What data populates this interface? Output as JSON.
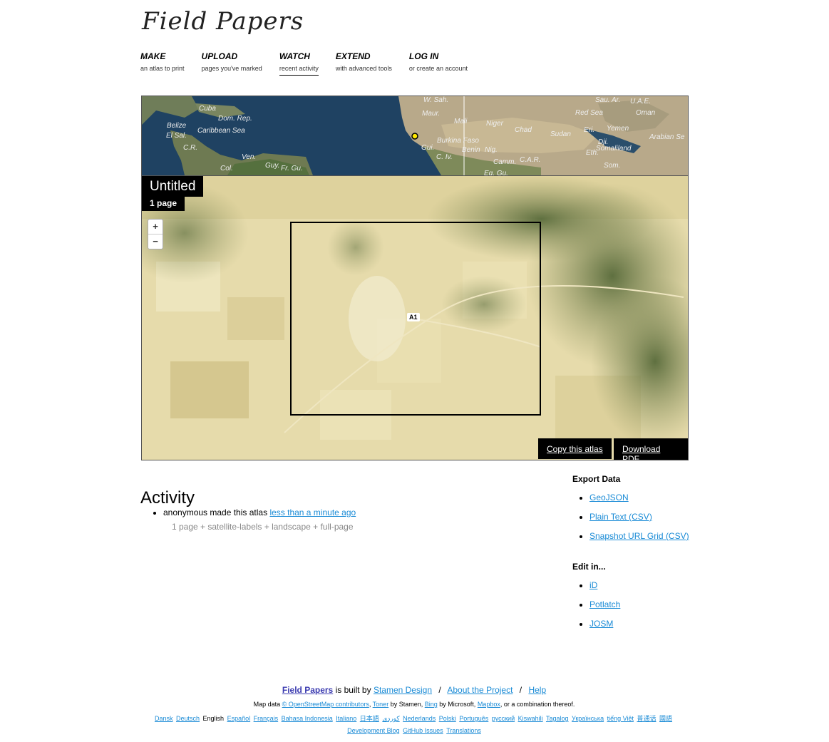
{
  "header": {
    "logo_text": "Field Papers"
  },
  "nav": [
    {
      "title": "MAKE",
      "subtitle": "an atlas to print",
      "active": false
    },
    {
      "title": "UPLOAD",
      "subtitle": "pages you've marked",
      "active": false
    },
    {
      "title": "WATCH",
      "subtitle": "recent activity",
      "active": true
    },
    {
      "title": "EXTEND",
      "subtitle": "with advanced tools",
      "active": false
    },
    {
      "title": "LOG IN",
      "subtitle": "or create an account",
      "active": false
    }
  ],
  "overview_map": {
    "labels": [
      "W. Sah.",
      "Cuba",
      "Dom. Rep.",
      "Belize",
      "Caribbean Sea",
      "El Sal.",
      "C.R.",
      "Ven.",
      "Col.",
      "Guy.",
      "Fr. Gu.",
      "Maur.",
      "Mali",
      "Niger",
      "Chad",
      "Sudan",
      "Red Sea",
      "Eri.",
      "Yemen",
      "Oman",
      "U.A.E.",
      "Sau. Ar.",
      "Arabian Se",
      "Burkina Faso",
      "Benin",
      "Nig.",
      "C. Iv.",
      "Gui.",
      "Camm.",
      "C.A.R.",
      "Eth.",
      "Dji.",
      "Somaliland",
      "Som.",
      "Eq. Gu."
    ]
  },
  "atlas": {
    "title": "Untitled",
    "page_count": "1 page",
    "page_label": "A1",
    "zoom_in": "+",
    "zoom_out": "−",
    "copy_button": "Copy this atlas",
    "download_button": "Download PDF"
  },
  "activity": {
    "heading": "Activity",
    "items": [
      {
        "actor_action": "anonymous made this atlas",
        "time": "less than a minute ago",
        "detail": "1 page + satellite-labels + landscape + full-page"
      }
    ]
  },
  "export": {
    "heading": "Export Data",
    "links": [
      "GeoJSON",
      "Plain Text (CSV)",
      "Snapshot URL Grid (CSV)"
    ]
  },
  "edit": {
    "heading": "Edit in...",
    "links": [
      "iD",
      "Potlatch",
      "JOSM"
    ]
  },
  "footer": {
    "brand": "Field Papers",
    "built_by_text": "is built by",
    "built_by_link": "Stamen Design",
    "about": "About the Project",
    "help": "Help",
    "map_data_prefix": "Map data",
    "osm_link": "© OpenStreetMap contributors",
    "toner": "Toner",
    "by_stamen": "by Stamen,",
    "bing": "Bing",
    "by_microsoft": "by Microsoft,",
    "mapbox": "Mapbox",
    "combination": ", or a combination thereof.",
    "languages": [
      "Dansk",
      "Deutsch",
      "English",
      "Español",
      "Français",
      "Bahasa Indonesia",
      "Italiano",
      "日本語",
      "کوردی",
      "Nederlands",
      "Polski",
      "Português",
      "русский",
      "Kiswahili",
      "Tagalog",
      "Українська",
      "tiếng Việt",
      "普通话",
      "國語"
    ],
    "current_language": "English",
    "dev_links": [
      "Development Blog",
      "GitHub Issues",
      "Translations"
    ]
  },
  "colors": {
    "link": "#1a8bd6",
    "black": "#000000",
    "ocean": "#1e3e5c",
    "land": "#e2d7a6"
  }
}
